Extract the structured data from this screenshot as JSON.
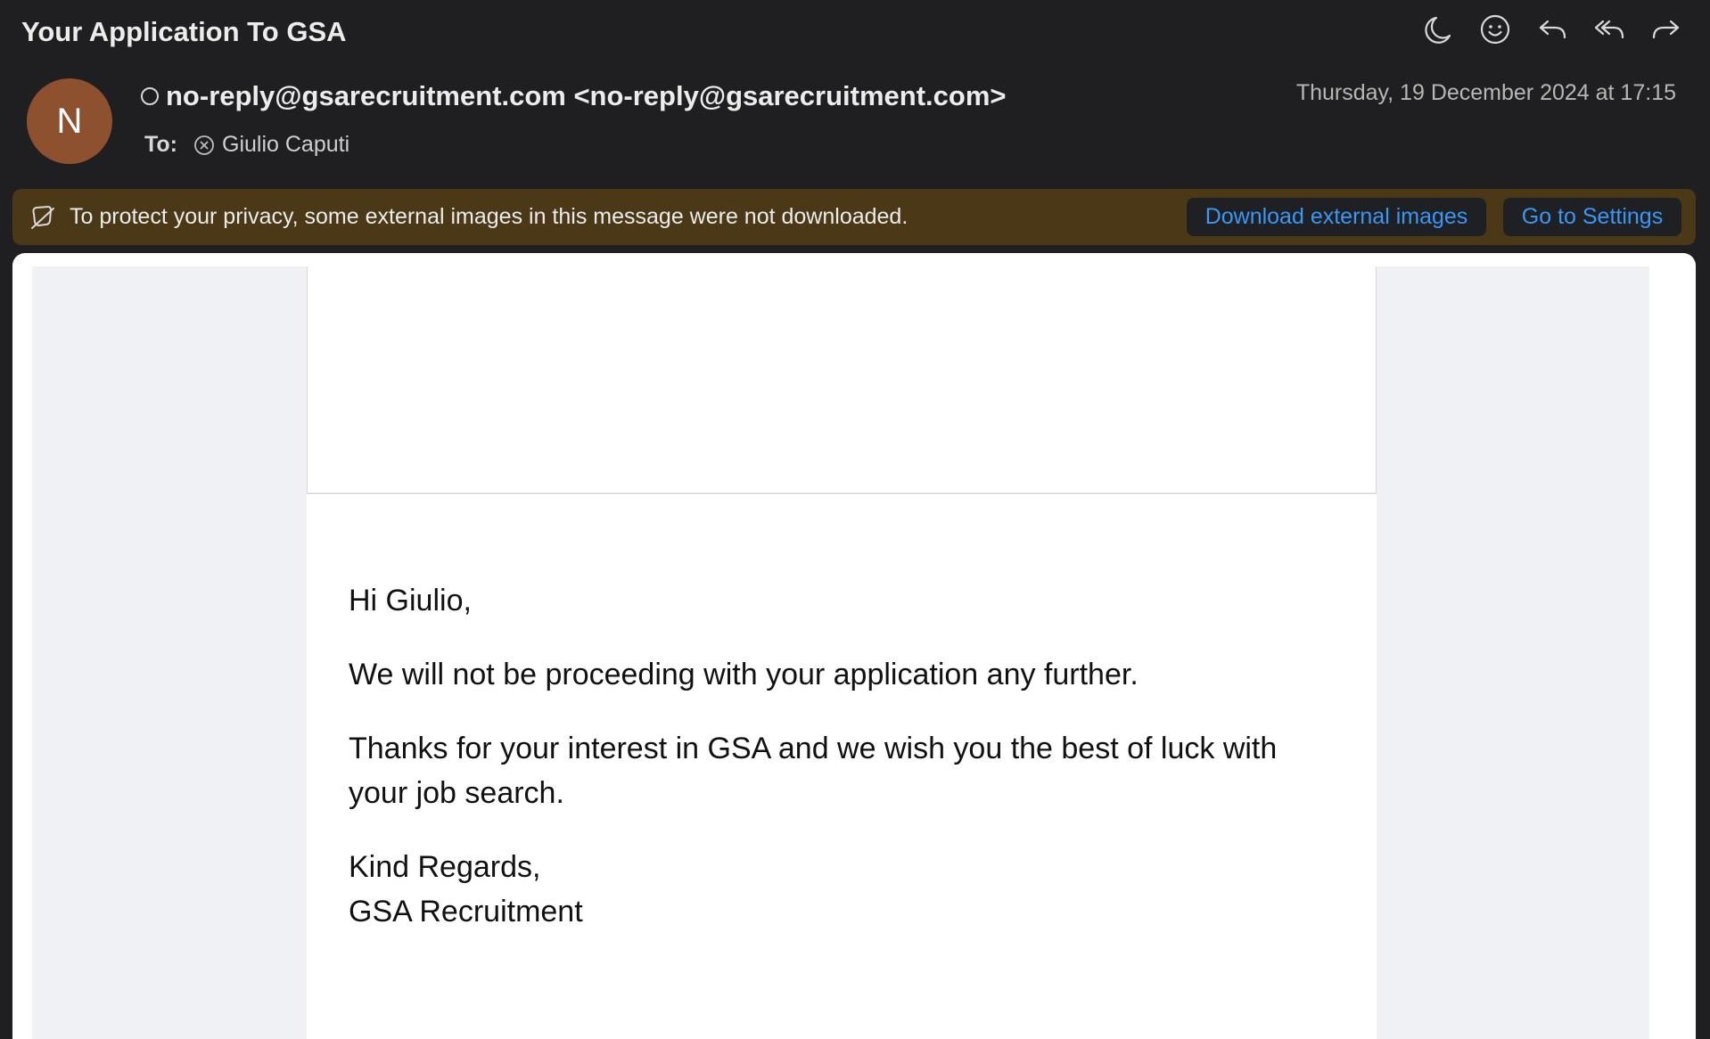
{
  "email": {
    "subject": "Your Application To GSA",
    "avatar_initial": "N",
    "sender": "no-reply@gsarecruitment.com <no-reply@gsarecruitment.com>",
    "date": "Thursday, 19 December 2024 at 17:15",
    "to_label": "To:",
    "recipient": "Giulio Caputi"
  },
  "toolbar": {
    "icons": [
      "moon-icon",
      "smiley-icon",
      "reply-icon",
      "reply-all-icon",
      "forward-icon"
    ]
  },
  "banner": {
    "message": "To protect your privacy, some external images in this message were not downloaded.",
    "download_label": "Download external images",
    "settings_label": "Go to Settings"
  },
  "body": {
    "greeting": "Hi Giulio,",
    "paragraph1": "We will not be proceeding with your application any further.",
    "paragraph2": "Thanks for your interest in GSA and we wish you the best of luck with your job search.",
    "closing": "Kind Regards,",
    "signature": "GSA Recruitment"
  },
  "colors": {
    "background": "#1f1f21",
    "avatar": "#8d5130",
    "banner": "#4a3816",
    "link": "#3b96f4",
    "mail_background": "#f0f1f5",
    "footer_bar": "#3a4450"
  }
}
